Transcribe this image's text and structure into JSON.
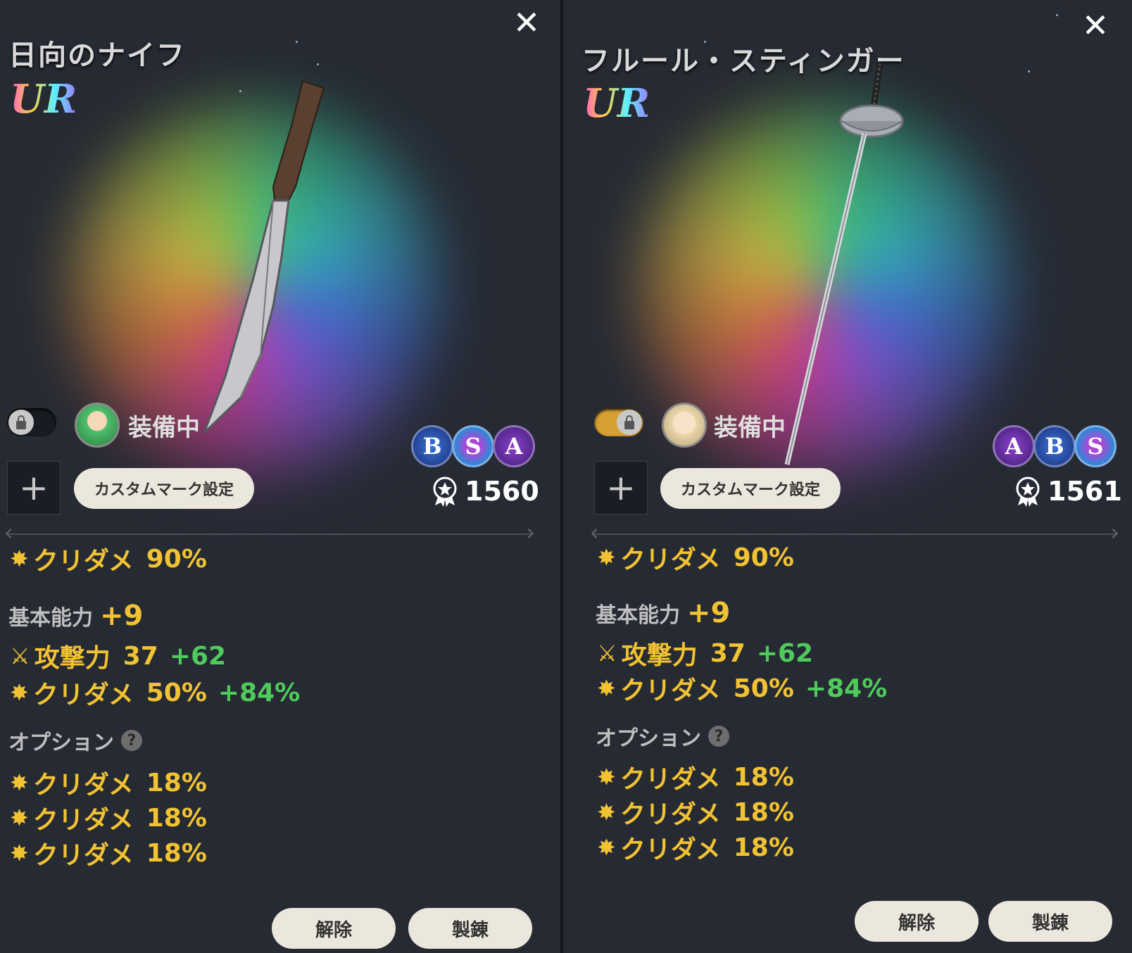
{
  "left": {
    "title": "日向のナイフ",
    "rarity": "UR",
    "close": "✕",
    "equipped": "装備中",
    "lock_on": false,
    "badges": [
      "B",
      "S",
      "A"
    ],
    "add": "+",
    "custom_mark": "カスタムマーク設定",
    "power": "1560",
    "main_stat": {
      "name": "クリダメ",
      "value": "90%"
    },
    "base_label": "基本能力",
    "base_bonus": "+9",
    "base_stats": [
      {
        "icon": "sword-icon",
        "name": "攻撃力",
        "value": "37",
        "plus": "+62"
      },
      {
        "icon": "burst-icon",
        "name": "クリダメ",
        "value": "50%",
        "plus": "+84%"
      }
    ],
    "option_label": "オプション",
    "help": "?",
    "options": [
      {
        "name": "クリダメ",
        "value": "18%"
      },
      {
        "name": "クリダメ",
        "value": "18%"
      },
      {
        "name": "クリダメ",
        "value": "18%"
      }
    ],
    "release": "解除",
    "refine": "製錬"
  },
  "right": {
    "title": "フルール・スティンガー",
    "rarity": "UR",
    "close": "✕",
    "equipped": "装備中",
    "lock_on": true,
    "badges": [
      "A",
      "B",
      "S"
    ],
    "add": "+",
    "custom_mark": "カスタムマーク設定",
    "power": "1561",
    "main_stat": {
      "name": "クリダメ",
      "value": "90%"
    },
    "base_label": "基本能力",
    "base_bonus": "+9",
    "base_stats": [
      {
        "icon": "sword-icon",
        "name": "攻撃力",
        "value": "37",
        "plus": "+62"
      },
      {
        "icon": "burst-icon",
        "name": "クリダメ",
        "value": "50%",
        "plus": "+84%"
      }
    ],
    "option_label": "オプション",
    "help": "?",
    "options": [
      {
        "name": "クリダメ",
        "value": "18%"
      },
      {
        "name": "クリダメ",
        "value": "18%"
      },
      {
        "name": "クリダメ",
        "value": "18%"
      }
    ],
    "release": "解除",
    "refine": "製錬"
  },
  "colors": {
    "stat_gold": "#f1c232",
    "stat_plus": "#4ecb5b",
    "panel_bg": "#262a33"
  }
}
